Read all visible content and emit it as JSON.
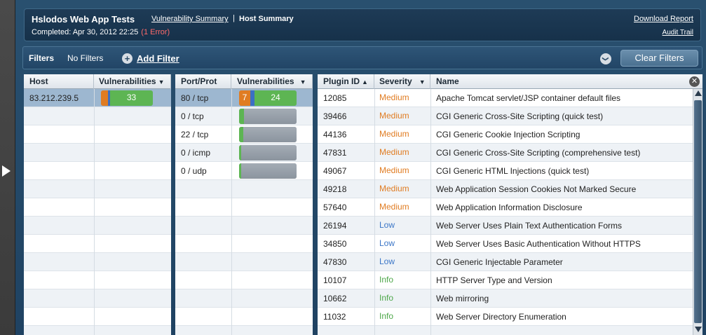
{
  "header": {
    "title": "Hslodos Web App Tests",
    "completed": "Completed: Apr 30, 2012 22:25",
    "error": "(1 Error)",
    "nav_vulnerability_summary": "Vulnerability Summary",
    "nav_separator": "|",
    "nav_host_summary": "Host Summary",
    "download_report": "Download Report",
    "audit_trail": "Audit Trail"
  },
  "filters": {
    "label": "Filters",
    "status": "No Filters",
    "add_icon": "+",
    "add_label": "Add Filter",
    "chevron_icon": "❯",
    "clear_label": "Clear Filters"
  },
  "host_table": {
    "headers": {
      "host": "Host",
      "vulnerabilities": "Vulnerabilities",
      "sort_icon": "▼"
    },
    "rows": [
      {
        "host": "83.212.239.5",
        "medium_label": "",
        "info_label": "33",
        "selected": true
      }
    ]
  },
  "port_table": {
    "headers": {
      "port": "Port/Prot",
      "vulnerabilities": "Vulnerabilities",
      "sort_icon": "▼"
    },
    "rows": [
      {
        "port": "80 / tcp",
        "medium_label": "7",
        "info_label": "24",
        "selected": true
      },
      {
        "port": "0 / tcp"
      },
      {
        "port": "22 / tcp"
      },
      {
        "port": "0 / icmp"
      },
      {
        "port": "0 / udp"
      }
    ]
  },
  "plugin_table": {
    "headers": {
      "plugin_id": "Plugin ID",
      "plugin_sort_icon": "▲",
      "severity": "Severity",
      "severity_sort_icon": "▼",
      "name": "Name"
    },
    "close_icon": "✕",
    "rows": [
      {
        "id": "12085",
        "severity": "Medium",
        "name": "Apache Tomcat servlet/JSP container default files"
      },
      {
        "id": "39466",
        "severity": "Medium",
        "name": "CGI Generic Cross-Site Scripting (quick test)"
      },
      {
        "id": "44136",
        "severity": "Medium",
        "name": "CGI Generic Cookie Injection Scripting"
      },
      {
        "id": "47831",
        "severity": "Medium",
        "name": "CGI Generic Cross-Site Scripting (comprehensive test)"
      },
      {
        "id": "49067",
        "severity": "Medium",
        "name": "CGI Generic HTML Injections (quick test)"
      },
      {
        "id": "49218",
        "severity": "Medium",
        "name": "Web Application Session Cookies Not Marked Secure"
      },
      {
        "id": "57640",
        "severity": "Medium",
        "name": "Web Application Information Disclosure"
      },
      {
        "id": "26194",
        "severity": "Low",
        "name": "Web Server Uses Plain Text Authentication Forms"
      },
      {
        "id": "34850",
        "severity": "Low",
        "name": "Web Server Uses Basic Authentication Without HTTPS"
      },
      {
        "id": "47830",
        "severity": "Low",
        "name": "CGI Generic Injectable Parameter"
      },
      {
        "id": "10107",
        "severity": "Info",
        "name": "HTTP Server Type and Version"
      },
      {
        "id": "10662",
        "severity": "Info",
        "name": "Web mirroring"
      },
      {
        "id": "11032",
        "severity": "Info",
        "name": "Web Server Directory Enumeration"
      }
    ]
  },
  "colors": {
    "medium": "#e07c22",
    "low": "#3b6fc4",
    "info": "#5db553",
    "selected_row": "#9db7d0"
  }
}
